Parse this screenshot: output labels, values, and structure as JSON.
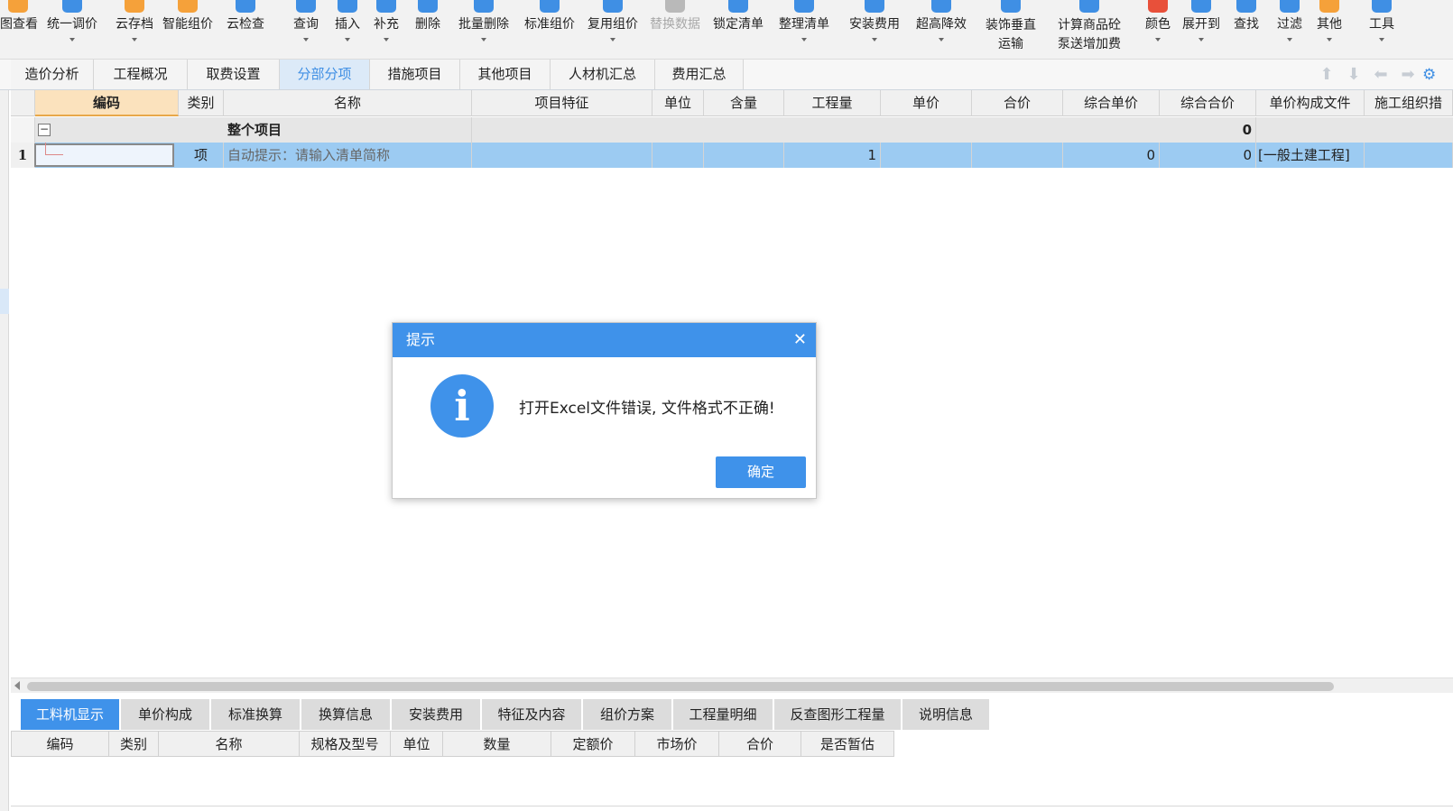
{
  "ribbon": {
    "items": [
      {
        "label": "图查看",
        "color": "#f5a13a",
        "caret": false
      },
      {
        "label": "统一调价",
        "color": "#3f8fe4",
        "caret": true
      },
      {
        "label": "云存档",
        "color": "#f5a13a",
        "caret": true
      },
      {
        "label": "智能组价",
        "color": "#f5a13a",
        "caret": false
      },
      {
        "label": "云检查",
        "color": "#3f8fe4",
        "caret": false
      },
      {
        "label": "查询",
        "color": "#3f8fe4",
        "caret": true
      },
      {
        "label": "插入",
        "color": "#3f8fe4",
        "caret": true
      },
      {
        "label": "补充",
        "color": "#3f8fe4",
        "caret": true
      },
      {
        "label": "删除",
        "color": "#3f8fe4",
        "caret": false
      },
      {
        "label": "批量删除",
        "color": "#3f8fe4",
        "caret": true
      },
      {
        "label": "标准组价",
        "color": "#3f8fe4",
        "caret": false
      },
      {
        "label": "复用组价",
        "color": "#3f8fe4",
        "caret": true
      },
      {
        "label": "替换数据",
        "color": "#b9b9b9",
        "caret": false,
        "disabled": true
      },
      {
        "label": "锁定清单",
        "color": "#3f8fe4",
        "caret": false
      },
      {
        "label": "整理清单",
        "color": "#3f8fe4",
        "caret": true
      },
      {
        "label": "安装费用",
        "color": "#3f8fe4",
        "caret": true
      },
      {
        "label": "超高降效",
        "color": "#3f8fe4",
        "caret": true
      },
      {
        "label": "装饰垂直\n运输",
        "color": "#3f8fe4",
        "caret": true
      },
      {
        "label": "计算商品砼\n泵送增加费",
        "color": "#3f8fe4",
        "caret": false
      },
      {
        "label": "颜色",
        "color": "#e8503a",
        "caret": true
      },
      {
        "label": "展开到",
        "color": "#3f8fe4",
        "caret": true
      },
      {
        "label": "查找",
        "color": "#3f8fe4",
        "caret": false
      },
      {
        "label": "过滤",
        "color": "#3f8fe4",
        "caret": true
      },
      {
        "label": "其他",
        "color": "#f5a13a",
        "caret": true
      },
      {
        "label": "工具",
        "color": "#3f8fe4",
        "caret": true
      }
    ]
  },
  "tabs": [
    "造价分析",
    "工程概况",
    "取费设置",
    "分部分项",
    "措施项目",
    "其他项目",
    "人材机汇总",
    "费用汇总"
  ],
  "active_tab": "分部分项",
  "grid": {
    "columns": [
      "编码",
      "类别",
      "名称",
      "项目特征",
      "单位",
      "含量",
      "工程量",
      "单价",
      "合价",
      "综合单价",
      "综合合价",
      "单价构成文件",
      "施工组织措"
    ],
    "group_row": {
      "name": "整个项目",
      "total": "0",
      "collapse_symbol": "−"
    },
    "item_row": {
      "index": "1",
      "type": "项",
      "name_hint": "自动提示：请输入清单简称",
      "quantity": "1",
      "unit_composite_price": "0",
      "composite_total": "0",
      "price_file": "[一般土建工程]"
    }
  },
  "nav_icons": [
    "arrow-up",
    "arrow-down",
    "arrow-left",
    "arrow-right"
  ],
  "bottom_tabs": [
    "工料机显示",
    "单价构成",
    "标准换算",
    "换算信息",
    "安装费用",
    "特征及内容",
    "组价方案",
    "工程量明细",
    "反查图形工程量",
    "说明信息"
  ],
  "active_bottom_tab": "工料机显示",
  "bottom_grid_columns": [
    "编码",
    "类别",
    "名称",
    "规格及型号",
    "单位",
    "数量",
    "定额价",
    "市场价",
    "合价",
    "是否暂估"
  ],
  "dialog": {
    "title": "提示",
    "close_symbol": "✕",
    "icon_letter": "i",
    "message": "打开Excel文件错误, 文件格式不正确!",
    "ok_label": "确定"
  },
  "colors": {
    "accent": "#3f92ea",
    "selected_row": "#9ccbf2",
    "header_selected": "#fbe2bd"
  }
}
